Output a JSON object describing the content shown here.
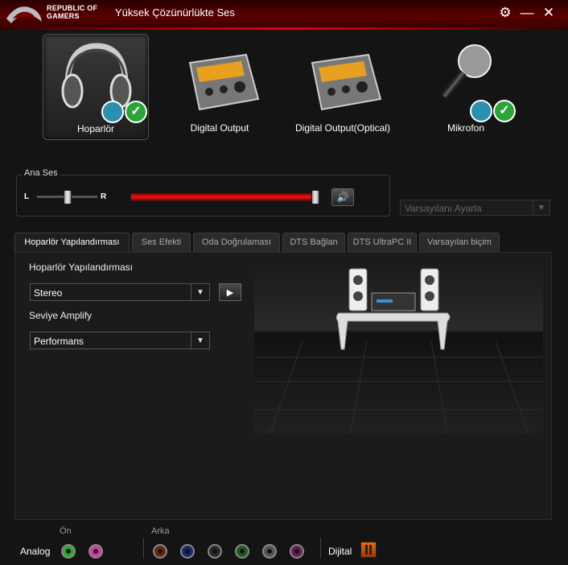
{
  "window": {
    "brand_line1": "REPUBLIC OF",
    "brand_line2": "GAMERS",
    "title": "Yüksek Çözünürlükte Ses"
  },
  "devices": [
    {
      "label": "Hoparlör",
      "selected": true,
      "icon": "headphones-icon"
    },
    {
      "label": "Digital Output",
      "selected": false,
      "icon": "digital-output-device-icon"
    },
    {
      "label": "Digital Output(Optical)",
      "selected": false,
      "icon": "digital-output-optical-device-icon"
    },
    {
      "label": "Mikrofon",
      "selected": false,
      "icon": "microphone-icon"
    }
  ],
  "master": {
    "label": "Ana Ses",
    "left_label": "L",
    "right_label": "R",
    "balance": 0.5,
    "volume": 1.0
  },
  "default_select": "Varsayılanı Ayarla",
  "tabs": [
    {
      "label": "Hoparlör Yapılandırması"
    },
    {
      "label": "Ses Efekti"
    },
    {
      "label": "Oda Doğrulaması"
    },
    {
      "label": "DTS Bağlan"
    },
    {
      "label": "DTS UltraPC II"
    },
    {
      "label": "Varsayılan biçim"
    }
  ],
  "panel": {
    "config_label": "Hoparlör Yapılandırması",
    "config_value": "Stereo",
    "amplify_label": "Seviye Amplify",
    "amplify_value": "Performans"
  },
  "jacks": {
    "front_label": "Ön",
    "rear_label": "Arka",
    "analog_label": "Analog",
    "digital_label": "Dijital",
    "front_colors": [
      "#2ea82e",
      "#d43ca6"
    ],
    "rear_colors": [
      "#6a2a12",
      "#1c2a6a",
      "#2a2a2a",
      "#1f5a1f",
      "#555555",
      "#6a1f4f"
    ]
  },
  "colors": {
    "accent": "#e00000",
    "check": "#2da43a",
    "chat": "#2b8fb0"
  }
}
